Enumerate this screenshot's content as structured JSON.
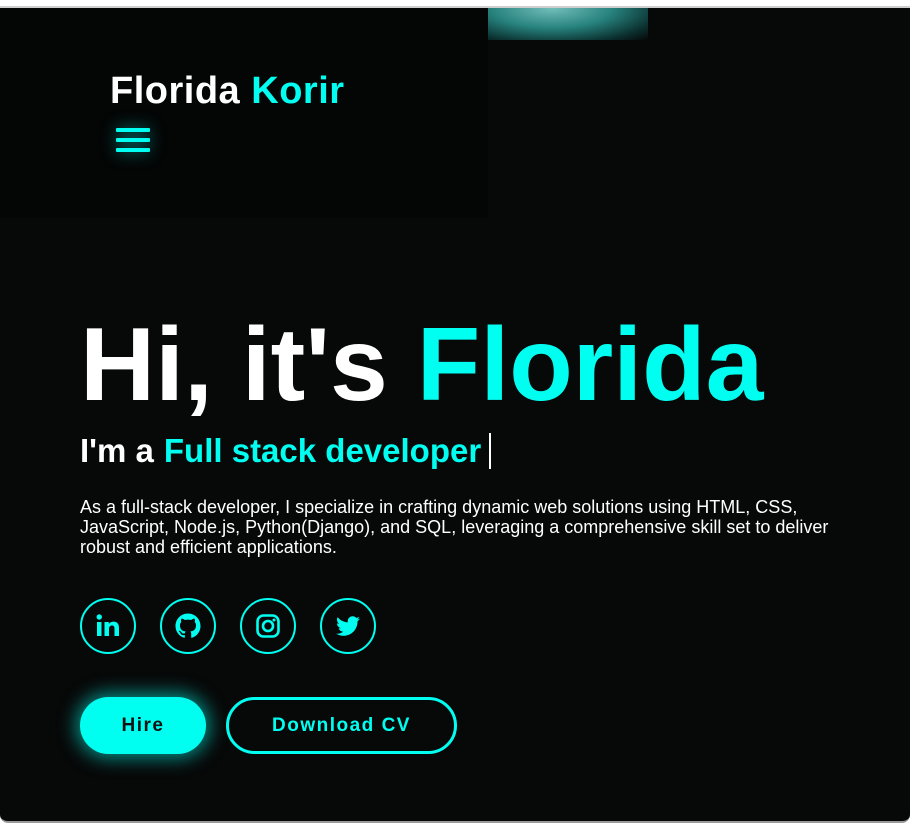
{
  "header": {
    "logo_first": "Florida",
    "logo_last": "Korir",
    "menu_icon": "hamburger-menu-icon"
  },
  "hero": {
    "greeting": "Hi, it's",
    "name": "Florida",
    "role_prefix": "I'm a",
    "role": "Full stack developer",
    "description": "As a full-stack developer, I specialize in crafting dynamic web solutions using HTML, CSS, JavaScript, Node.js, Python(Django), and SQL, leveraging a comprehensive skill set to deliver robust and efficient applications."
  },
  "socials": [
    {
      "icon": "linkedin-icon"
    },
    {
      "icon": "github-icon"
    },
    {
      "icon": "instagram-icon"
    },
    {
      "icon": "twitter-icon"
    }
  ],
  "buttons": {
    "hire": "Hire",
    "download_cv": "Download CV"
  },
  "colors": {
    "accent": "#00fff0",
    "background": "#070808",
    "text": "#ffffff"
  }
}
